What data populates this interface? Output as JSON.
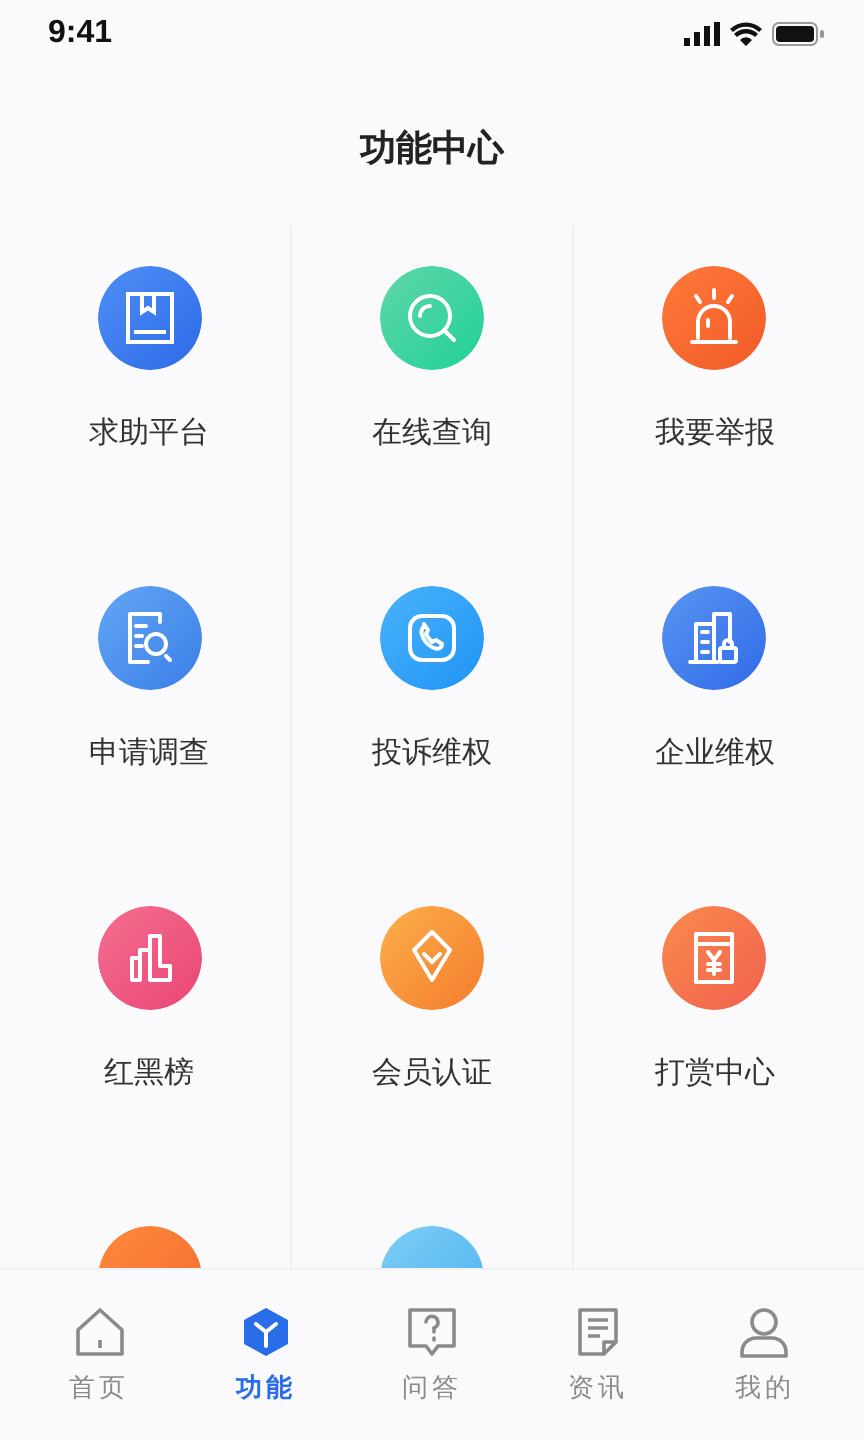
{
  "status_bar": {
    "time": "9:41"
  },
  "title": "功能中心",
  "items": [
    {
      "kind": "book",
      "label": "求助平台"
    },
    {
      "kind": "search",
      "label": "在线查询"
    },
    {
      "kind": "alarm",
      "label": "我要举报"
    },
    {
      "kind": "doc-search",
      "label": "申请调查"
    },
    {
      "kind": "phone",
      "label": "投诉维权"
    },
    {
      "kind": "building",
      "label": "企业维权"
    },
    {
      "kind": "chart",
      "label": "红黑榜"
    },
    {
      "kind": "diamond",
      "label": "会员认证"
    },
    {
      "kind": "envelope",
      "label": "打赏中心"
    },
    {
      "kind": "partial-orange"
    },
    {
      "kind": "partial-blue"
    }
  ],
  "tabs": [
    {
      "kind": "home",
      "label": "首页",
      "selected": false
    },
    {
      "kind": "cube",
      "label": "功能",
      "selected": true
    },
    {
      "kind": "question",
      "label": "问答",
      "selected": false
    },
    {
      "kind": "news",
      "label": "资讯",
      "selected": false
    },
    {
      "kind": "user",
      "label": "我的",
      "selected": false
    }
  ]
}
